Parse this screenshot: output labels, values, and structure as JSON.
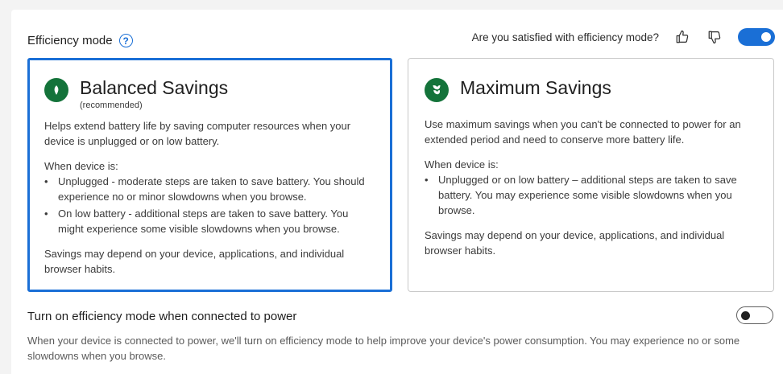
{
  "header": {
    "title": "Efficiency mode",
    "help_icon": "question-circle-icon",
    "feedback_question": "Are you satisfied with efficiency mode?",
    "efficiency_toggle_on": true,
    "accent_color": "#1a6fd6"
  },
  "cards": {
    "balanced": {
      "title": "Balanced Savings",
      "subtitle": "(recommended)",
      "icon": "leaf-icon",
      "selected": true,
      "description": "Helps extend battery life by saving computer resources when your device is unplugged or on low battery.",
      "when_label": "When device is:",
      "bullets": [
        "Unplugged - moderate steps are taken to save battery. You should experience no or minor slowdowns when you browse.",
        "On low battery - additional steps are taken to save battery. You might experience some visible slowdowns when you browse."
      ],
      "footer": "Savings may depend on your device, applications, and individual browser habits."
    },
    "maximum": {
      "title": "Maximum Savings",
      "icon": "leaves-icon",
      "selected": false,
      "description": "Use maximum savings when you can't be connected to power for an extended period and need to conserve more battery life.",
      "when_label": "When device is:",
      "bullets": [
        "Unplugged or on low battery – additional steps are taken to save battery. You may experience some visible slowdowns when you browse."
      ],
      "footer": "Savings may depend on your device, applications, and individual browser habits."
    }
  },
  "power": {
    "title": "Turn on efficiency mode when connected to power",
    "toggle_on": false,
    "description": "When your device is connected to power, we'll turn on efficiency mode to help improve your device's power consumption. You may experience no or some slowdowns when you browse."
  }
}
